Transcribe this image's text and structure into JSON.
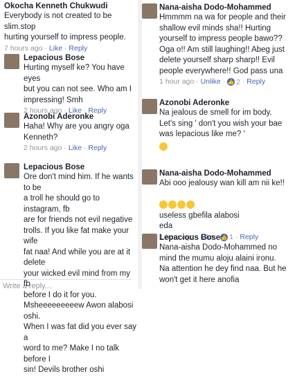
{
  "left": {
    "comments": [
      {
        "name": "Okocha Kenneth Chukwudi",
        "text": "Everybody is not created to be slim.stop\nhurting yourself to impress people.",
        "time": "7 hours ago",
        "like": "Like",
        "reply": "Reply"
      },
      {
        "name": "Lepacious Bose",
        "text": "Hurting myself ke? You have eyes\nbut you can not see. Who am I\nimpressing! Smh",
        "time": "2 hours ago",
        "like": "Like",
        "reply": "Reply"
      },
      {
        "name": "Azonobi Aderonke",
        "text": "Haha! Why are you angry oga\nKenneth?",
        "time": "2 hours ago",
        "like": "Like",
        "reply": "Reply"
      },
      {
        "name": "Lepacious Bose",
        "text": "Ore don't mind him. If he wants to be\na troll he should go to instagram, fb\nare for friends not evil negative\ntrolls. If you like fat make your wife\nfat naa! And while you are at it delete\nyour wicked evil mind from my fb\nbefore I do it for you.\nMsheeeeeeeeew Awon alabosi oshi.\nWhen I was fat did you ever say a\nword to me? Make I no talk before I\nsin! Devils brother oshi"
      }
    ],
    "reply_placeholder": "Write a reply..."
  },
  "right": {
    "comments": [
      {
        "name": "Nana-aisha Dodo-Mohammed",
        "text": "Hmmmm na wa for people and their\nshallow evil minds sha!! Hurting\nyourself to impress people bawo??\nOga o!! Am still laughing!! Abeg just\ndelete yourself sharp sharp!! Evil\npeople everywhere!! God pass una",
        "time": "1 hour ago",
        "like": "Unlike",
        "likes": "2",
        "reply": "Reply"
      },
      {
        "name": "Azonobi Aderonke",
        "text": "Na jealous de smell for im body.\nLet's sing ' don't you wish your bae\nwas lepacious like me? '"
      },
      {
        "name": "Nana-aisha Dodo-Mohammed",
        "text": "Abi ooo jealousy wan kill am nii ke!!",
        "text2": "useless gbefila alabosi\neda",
        "time": "1 hour ago",
        "like": "Like",
        "likes": "1",
        "reply": "Reply"
      },
      {
        "name": "Lepacious Bose",
        "text": "Nana-aisha Dodo-Mohammed no\nmind the mumu aloju alaini ironu.\nNa attention he dey find naa. But he\nwon't get it here anofia"
      }
    ]
  },
  "colors": {
    "link": "#4267b2",
    "meta": "#90949c",
    "text": "#1d2129"
  }
}
